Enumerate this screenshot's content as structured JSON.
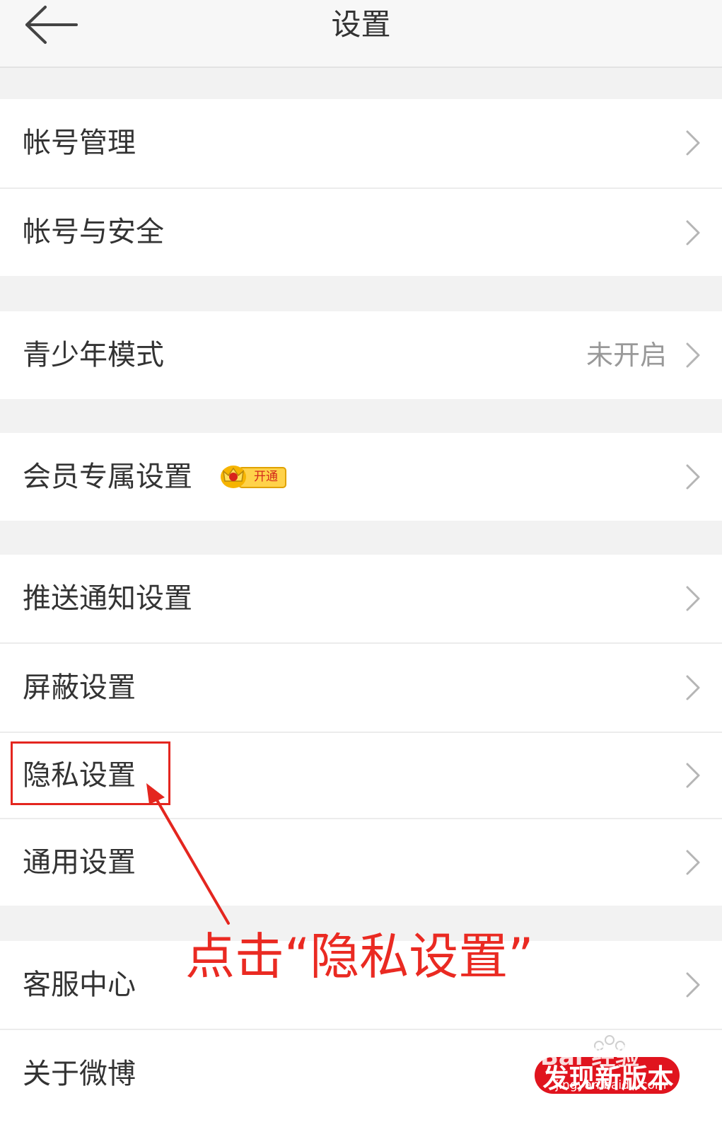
{
  "header": {
    "title": "设置",
    "back_icon": "arrow-left-icon"
  },
  "groups": [
    {
      "items": [
        {
          "label": "帐号管理"
        },
        {
          "label": "帐号与安全"
        }
      ]
    },
    {
      "items": [
        {
          "label": "青少年模式",
          "value": "未开启"
        }
      ]
    },
    {
      "items": [
        {
          "label": "会员专属设置",
          "badge": "开通",
          "badge_icon": "crown-icon"
        }
      ]
    },
    {
      "items": [
        {
          "label": "推送通知设置"
        },
        {
          "label": "屏蔽设置"
        },
        {
          "label": "隐私设置"
        },
        {
          "label": "通用设置"
        }
      ]
    },
    {
      "items": [
        {
          "label": "客服中心"
        },
        {
          "label": "关于微博"
        }
      ]
    }
  ],
  "annotation": {
    "text": "点击“隐私设置”",
    "color": "#ea2a22"
  },
  "watermark": {
    "top": "Bai 经验",
    "main": "发现新版本",
    "sub": "jingyan.baidu.com"
  },
  "colors": {
    "background": "#f2f2f2",
    "row": "#ffffff",
    "text": "#333333",
    "secondary_text": "#999999",
    "highlight": "#e4261f"
  }
}
